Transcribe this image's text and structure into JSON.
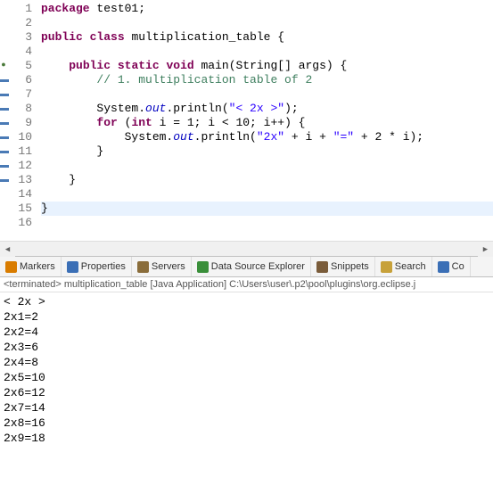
{
  "editor": {
    "lines": [
      {
        "num": "1",
        "tokens": [
          {
            "cls": "kw",
            "t": "package"
          },
          {
            "cls": "plain",
            "t": " test01;"
          }
        ]
      },
      {
        "num": "2",
        "tokens": []
      },
      {
        "num": "3",
        "tokens": [
          {
            "cls": "kw",
            "t": "public"
          },
          {
            "cls": "plain",
            "t": " "
          },
          {
            "cls": "kw",
            "t": "class"
          },
          {
            "cls": "plain",
            "t": " multiplication_table {"
          }
        ]
      },
      {
        "num": "4",
        "tokens": []
      },
      {
        "num": "5",
        "run_marker": true,
        "tokens": [
          {
            "cls": "plain",
            "t": "    "
          },
          {
            "cls": "kw",
            "t": "public"
          },
          {
            "cls": "plain",
            "t": " "
          },
          {
            "cls": "kw",
            "t": "static"
          },
          {
            "cls": "plain",
            "t": " "
          },
          {
            "cls": "kw",
            "t": "void"
          },
          {
            "cls": "plain",
            "t": " main(String[] args) {"
          }
        ]
      },
      {
        "num": "6",
        "mark": true,
        "tokens": [
          {
            "cls": "plain",
            "t": "        "
          },
          {
            "cls": "com",
            "t": "// 1. multiplication table of 2"
          }
        ]
      },
      {
        "num": "7",
        "mark": true,
        "tokens": []
      },
      {
        "num": "8",
        "mark": true,
        "tokens": [
          {
            "cls": "plain",
            "t": "        System."
          },
          {
            "cls": "sf",
            "t": "out"
          },
          {
            "cls": "plain",
            "t": ".println("
          },
          {
            "cls": "str",
            "t": "\"< 2x >\""
          },
          {
            "cls": "plain",
            "t": ");"
          }
        ]
      },
      {
        "num": "9",
        "mark": true,
        "tokens": [
          {
            "cls": "plain",
            "t": "        "
          },
          {
            "cls": "kw",
            "t": "for"
          },
          {
            "cls": "plain",
            "t": " ("
          },
          {
            "cls": "kw",
            "t": "int"
          },
          {
            "cls": "plain",
            "t": " i = 1; i < 10; i++) {"
          }
        ]
      },
      {
        "num": "10",
        "mark": true,
        "tokens": [
          {
            "cls": "plain",
            "t": "            System."
          },
          {
            "cls": "sf",
            "t": "out"
          },
          {
            "cls": "plain",
            "t": ".println("
          },
          {
            "cls": "str",
            "t": "\"2x\""
          },
          {
            "cls": "plain",
            "t": " + i + "
          },
          {
            "cls": "str",
            "t": "\"=\""
          },
          {
            "cls": "plain",
            "t": " + 2 * i);"
          }
        ]
      },
      {
        "num": "11",
        "mark": true,
        "tokens": [
          {
            "cls": "plain",
            "t": "        }"
          }
        ]
      },
      {
        "num": "12",
        "mark": true,
        "tokens": []
      },
      {
        "num": "13",
        "mark": true,
        "tokens": [
          {
            "cls": "plain",
            "t": "    }"
          }
        ]
      },
      {
        "num": "14",
        "tokens": []
      },
      {
        "num": "15",
        "highlight": true,
        "tokens": [
          {
            "cls": "plain",
            "t": "}"
          }
        ]
      },
      {
        "num": "16",
        "tokens": []
      }
    ]
  },
  "tabs": [
    {
      "icon": "markers-icon",
      "label": "Markers",
      "color": "#d97c00"
    },
    {
      "icon": "properties-icon",
      "label": "Properties",
      "color": "#3b6fb6"
    },
    {
      "icon": "servers-icon",
      "label": "Servers",
      "color": "#8a6d3b"
    },
    {
      "icon": "data-icon",
      "label": "Data Source Explorer",
      "color": "#3a8f3a"
    },
    {
      "icon": "snippets-icon",
      "label": "Snippets",
      "color": "#7a5c3a"
    },
    {
      "icon": "search-icon",
      "label": "Search",
      "color": "#c7a13a"
    },
    {
      "icon": "console-icon",
      "label": "Co",
      "color": "#3b6fb6"
    }
  ],
  "status": "<terminated> multiplication_table [Java Application] C:\\Users\\user\\.p2\\pool\\plugins\\org.eclipse.j",
  "console": [
    "< 2x >",
    "2x1=2",
    "2x2=4",
    "2x3=6",
    "2x4=8",
    "2x5=10",
    "2x6=12",
    "2x7=14",
    "2x8=16",
    "2x9=18"
  ]
}
